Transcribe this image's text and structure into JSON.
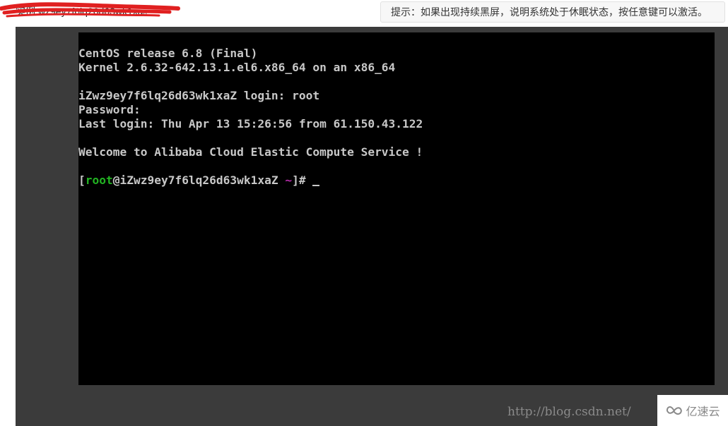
{
  "header": {
    "redacted_label": "实例 wz9ey7f6lq26d63wk1xa。",
    "hint": "提示：如果出现持续黑屏，说明系统处于休眠状态，按任意键可以激活。"
  },
  "terminal": {
    "lines": [
      "CentOS release 6.8 (Final)",
      "Kernel 2.6.32-642.13.1.el6.x86_64 on an x86_64",
      "",
      "iZwz9ey7f6lq26d63wk1xaZ login: root",
      "Password:",
      "Last login: Thu Apr 13 15:26:56 from 61.150.43.122",
      "",
      "Welcome to Alibaba Cloud Elastic Compute Service !",
      ""
    ],
    "prompt": {
      "open_bracket": "[",
      "user": "root",
      "host": "@iZwz9ey7f6lq26d63wk1xaZ ",
      "dir": "~",
      "close": "]# "
    }
  },
  "watermark": {
    "url": "http://blog.csdn.net/",
    "logo_text": "亿速云",
    "logo_icon": "cloud-infinity-icon"
  },
  "colors": {
    "terminal_bg": "#000000",
    "terminal_text": "#c8c8c8",
    "prompt_user": "#22b322",
    "prompt_dir": "#b42aa8",
    "frame_bg": "#3b3b3b",
    "redaction": "#e02020"
  }
}
